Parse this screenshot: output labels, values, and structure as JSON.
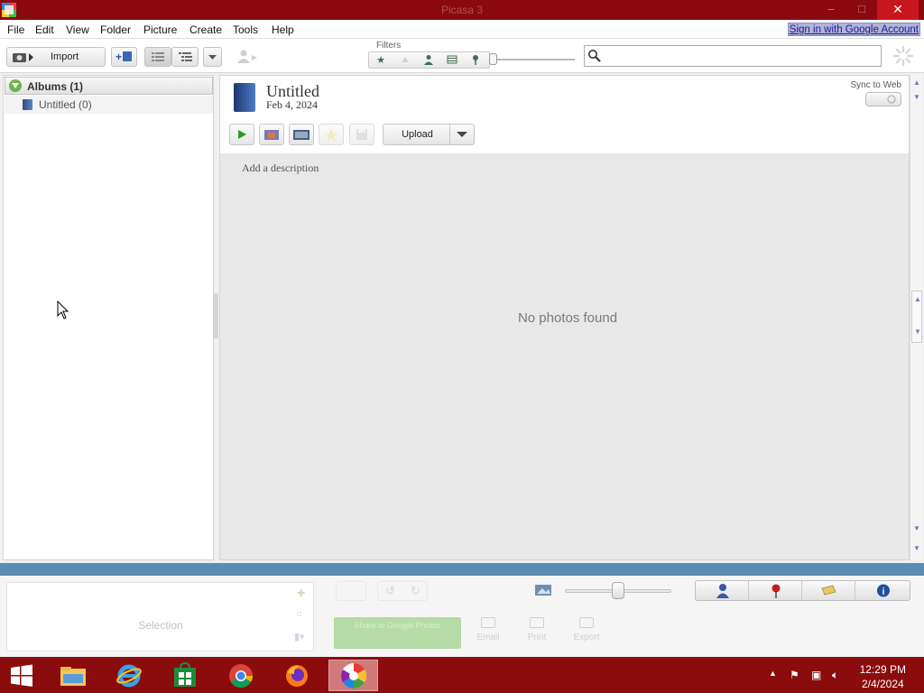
{
  "window": {
    "title": "Picasa 3",
    "minimize": "–",
    "maximize": "□",
    "close": "✕"
  },
  "menu": {
    "items": [
      "File",
      "Edit",
      "View",
      "Folder",
      "Picture",
      "Create",
      "Tools",
      "Help"
    ],
    "signin": "Sign in with Google Account"
  },
  "toolbar": {
    "import_label": "Import",
    "filters_label": "Filters",
    "search_placeholder": "",
    "filter_icons": [
      "star-icon",
      "upload-icon",
      "person-icon",
      "movie-icon",
      "geotag-icon"
    ]
  },
  "library": {
    "albums_header": "Albums (1)",
    "album_item": "Untitled (0)"
  },
  "album": {
    "title": "Untitled",
    "date": "Feb 4, 2024",
    "sync_label": "Sync to Web",
    "upload_label": "Upload",
    "add_description": "Add a description",
    "empty_text": "No photos found"
  },
  "tray": {
    "selection_label": "Selection",
    "share_label": "Share to Google Photos",
    "email_label": "Email",
    "print_label": "Print",
    "export_label": "Export",
    "zoom_level": 0.45
  },
  "taskbar": {
    "time": "12:29 PM",
    "date": "2/4/2024",
    "apps": [
      "start-icon",
      "file-explorer-icon",
      "internet-explorer-icon",
      "store-icon",
      "chrome-icon",
      "firefox-icon",
      "picasa-icon"
    ]
  },
  "colors": {
    "titlebar": "#8a0a10",
    "close": "#c9161c",
    "taskbar": "#8a0c0c",
    "accent_blue": "#5c8bb4"
  }
}
